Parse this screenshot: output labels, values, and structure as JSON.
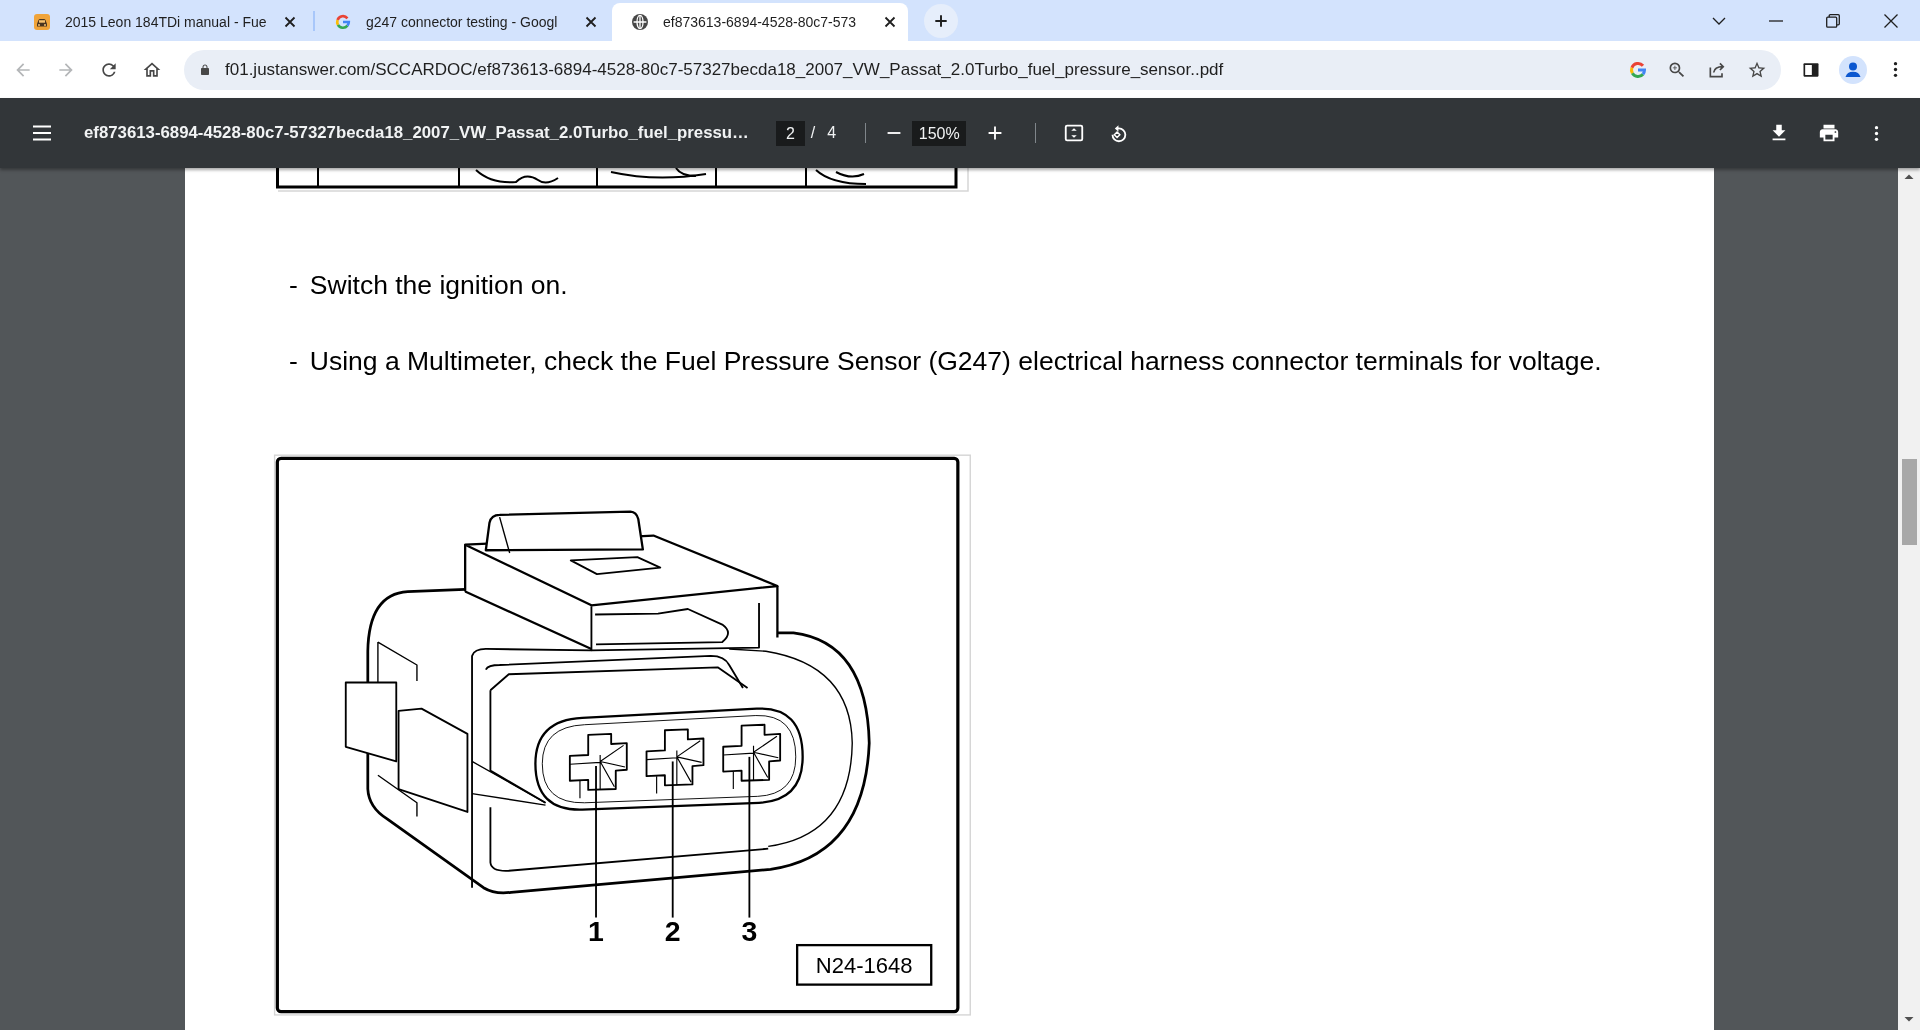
{
  "browser": {
    "tabs": [
      {
        "title": "2015 Leon 184TDi manual - Fue",
        "selected": false
      },
      {
        "title": "g247 connector testing - Googl",
        "selected": false
      },
      {
        "title": "ef873613-6894-4528-80c7-573",
        "selected": true
      }
    ],
    "back_disabled": true,
    "forward_disabled": true,
    "address": "f01.justanswer.com/SCCARDOC/ef873613-6894-4528-80c7-57327becda18_2007_VW_Passat_2.0Turbo_fuel_pressure_sensor..pdf"
  },
  "pdf_viewer": {
    "title": "ef873613-6894-4528-80c7-57327becda18_2007_VW_Passat_2.0Turbo_fuel_pressu…",
    "page_number": "2",
    "page_separator": "/",
    "page_count": "4",
    "zoom": "150%"
  },
  "document": {
    "steps": [
      {
        "marker": "-",
        "text": "Switch the ignition on."
      },
      {
        "marker": "-",
        "text": "Using a Multimeter, check the Fuel Pressure Sensor (G247) electrical harness connector terminals for voltage."
      }
    ],
    "figure": {
      "pin_labels": [
        "1",
        "2",
        "3"
      ],
      "code": "N24-1648"
    }
  }
}
